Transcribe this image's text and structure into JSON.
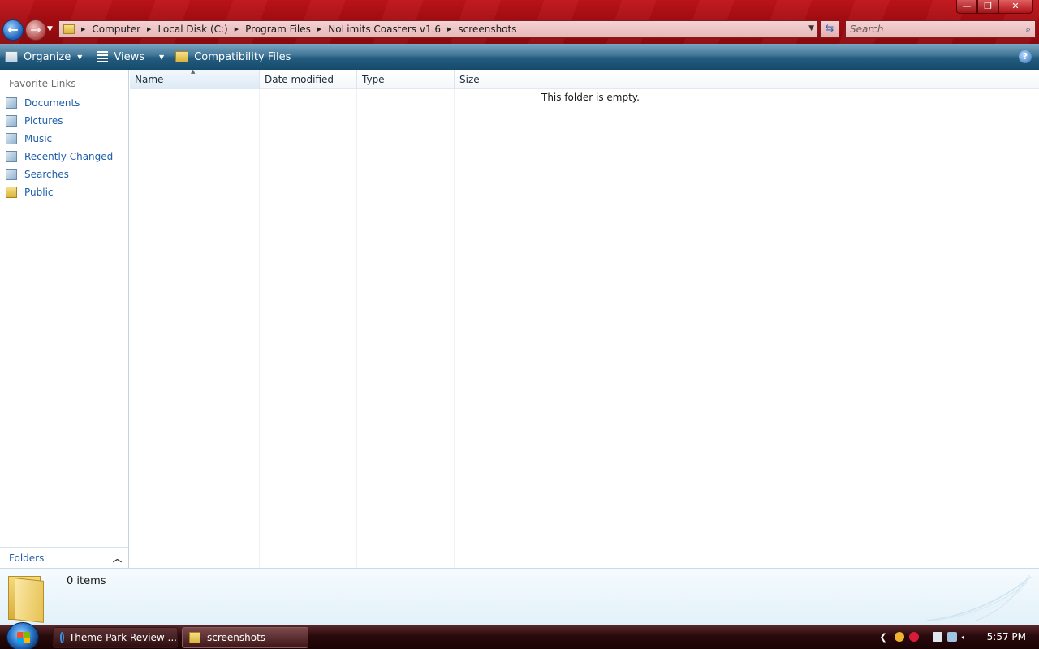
{
  "window": {
    "controls": {
      "minimize": "—",
      "maximize": "❐",
      "close": "✕"
    }
  },
  "address": {
    "crumbs": [
      "Computer",
      "Local Disk (C:)",
      "Program Files",
      "NoLimits Coasters v1.6",
      "screenshots"
    ]
  },
  "search": {
    "placeholder": "Search"
  },
  "toolbar": {
    "organize": "Organize",
    "views": "Views",
    "compatibility": "Compatibility Files",
    "help": "?"
  },
  "navpane": {
    "title": "Favorite Links",
    "links": [
      "Documents",
      "Pictures",
      "Music",
      "Recently Changed",
      "Searches",
      "Public"
    ],
    "folders_label": "Folders"
  },
  "filelist": {
    "columns": [
      "Name",
      "Date modified",
      "Type",
      "Size"
    ],
    "empty_message": "This folder is empty."
  },
  "details": {
    "item_count": "0 items"
  },
  "taskbar": {
    "tasks": [
      "Theme Park Review ...",
      "screenshots"
    ],
    "clock": "5:57 PM"
  },
  "colors": {
    "title_red": "#a90d12",
    "toolbar_blue": "#225c80",
    "link_blue": "#1e5ea8"
  }
}
